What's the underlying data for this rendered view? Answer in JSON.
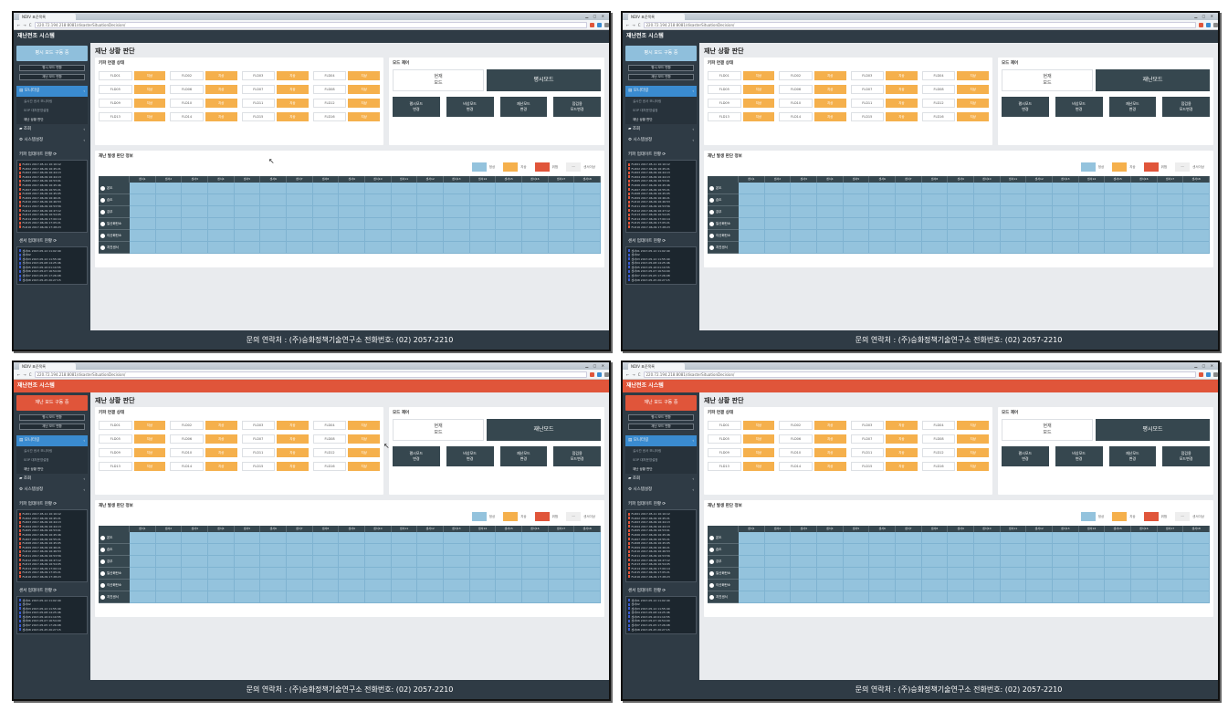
{
  "browser": {
    "tab_title": "NDIV 표준목록",
    "url": "220.72.194.218:8081/disasterSituationDecision/",
    "window_controls": "▁ ▢ ✕"
  },
  "app_title": "재난전조 시스템",
  "page_title": "재난 상황 판단",
  "sidebar": {
    "small_buttons": [
      "평시 모드 변환",
      "재난 모드 변환"
    ],
    "nav": [
      {
        "label": "모니터링",
        "icon": "monitor-icon"
      },
      {
        "label": "조회",
        "icon": "folder-icon"
      },
      {
        "label": "시스템설정",
        "icon": "settings-icon"
      }
    ],
    "sub_items": [
      "실시간 센서 모니터링",
      "SOP 대처운영설정",
      "재난 상황 판단"
    ],
    "kiwa_update_head": "키파 업데이트 현황",
    "sensor_update_head": "센서 업데이트 현황",
    "kiwa_logs": [
      "FLD01 2017-05-11 10:10:12",
      "FLD02 2017-06-09 16:45:21",
      "FLD03 2017-06-09 16:44:13",
      "FLD04 2017-06-09 16:44:13",
      "FLD05 2017-06-09 16:53:01",
      "FLD06 2017-06-09 16:45:46",
      "FLD07 2017-06-09 16:55:21",
      "FLD08 2017-06-09 16:45:05",
      "FLD09 2017-06-09 16:46:21",
      "FLD10 2017-06-09 16:46:53",
      "FLD11 2017-06-09 16:53:56",
      "FLD12 2017-06-09 16:47:12",
      "FLD13 2017-06-09 16:54:05",
      "FLD14 2017-06-09 17:00:14",
      "FLD15 2017-06-09 17:05:21",
      "FLD16 2017-06-09 17:28:23"
    ],
    "sensor_logs": [
      "센서01 2017-05-12 11:02:40",
      "센서02",
      "센서03 2017-05-12 11:55:40",
      "센서04 2017-05-08 14:25:46",
      "센서05 2017-05-16 01:10:55",
      "센서06 2017-05-07 16:54:00",
      "센서07 2017-05-05 17:26:08",
      "센서08 2017-05-25 20:27:15"
    ]
  },
  "kiwa_status": {
    "title": "키파 연결 상태",
    "items": [
      {
        "name": "FLD01",
        "status": "지상"
      },
      {
        "name": "FLD02",
        "status": "지상"
      },
      {
        "name": "FLD03",
        "status": "지상"
      },
      {
        "name": "FLD04",
        "status": "지상"
      },
      {
        "name": "FLD05",
        "status": "지상"
      },
      {
        "name": "FLD06",
        "status": "지상"
      },
      {
        "name": "FLD07",
        "status": "지상"
      },
      {
        "name": "FLD08",
        "status": "지상"
      },
      {
        "name": "FLD09",
        "status": "지상"
      },
      {
        "name": "FLD10",
        "status": "지상"
      },
      {
        "name": "FLD11",
        "status": "지상"
      },
      {
        "name": "FLD12",
        "status": "지상"
      },
      {
        "name": "FLD13",
        "status": "지상"
      },
      {
        "name": "FLD14",
        "status": "지상"
      },
      {
        "name": "FLD15",
        "status": "지상"
      },
      {
        "name": "FLD16",
        "status": "지상"
      }
    ]
  },
  "mode_control": {
    "title": "모드 제어",
    "current_label_1": "현재",
    "current_label_2": "모드",
    "buttons": [
      {
        "l1": "평시모드",
        "l2": "변경"
      },
      {
        "l1": "비상모드",
        "l2": "변경"
      },
      {
        "l1": "재난모드",
        "l2": "변경"
      },
      {
        "l1": "점검용",
        "l2": "모드변경"
      }
    ]
  },
  "disaster_info": {
    "title": "재난 발생 판단 정보",
    "legend": [
      {
        "label": "정상",
        "color": "#94c3dd"
      },
      {
        "label": "지상",
        "color": "#f5b04c"
      },
      {
        "label": "위험",
        "color": "#e0553a"
      },
      {
        "label": "센서이상",
        "color": "#eeeeee",
        "mark": "—"
      }
    ],
    "columns": [
      "센서1",
      "센서2",
      "센서3",
      "센서4",
      "센서5",
      "센서6",
      "센서7",
      "센서8",
      "센서9",
      "센서10",
      "센서11",
      "센서12",
      "센서13",
      "센서14",
      "센서15",
      "센서16",
      "센서17",
      "센서18"
    ],
    "rows": [
      "온도",
      "습도",
      "강우",
      "일산화탄소",
      "이산화탄소",
      "지진센서"
    ]
  },
  "footer": "문의 연락처 : (주)승화정책기술연구소 전화번호: (02) 2057-2210",
  "shots": [
    {
      "status_button": "평시 모드 구동 중",
      "theme": "normal",
      "big_mode": "평시모드",
      "cursor": "↖"
    },
    {
      "status_button": "평시 모드 구동 중",
      "theme": "normal",
      "big_mode": "재난모드",
      "cursor": ""
    },
    {
      "status_button": "재난 모드 구동 중",
      "theme": "red",
      "big_mode": "재난모드",
      "cursor": "↖"
    },
    {
      "status_button": "재난 모드 구동 중",
      "theme": "red",
      "big_mode": "평시모드",
      "cursor": ""
    }
  ],
  "colors": {
    "accent": "#3a8bd0",
    "normal": "#8fbfdc",
    "danger": "#e0553a",
    "warn": "#f5b04c",
    "dark": "#2f3b45"
  }
}
